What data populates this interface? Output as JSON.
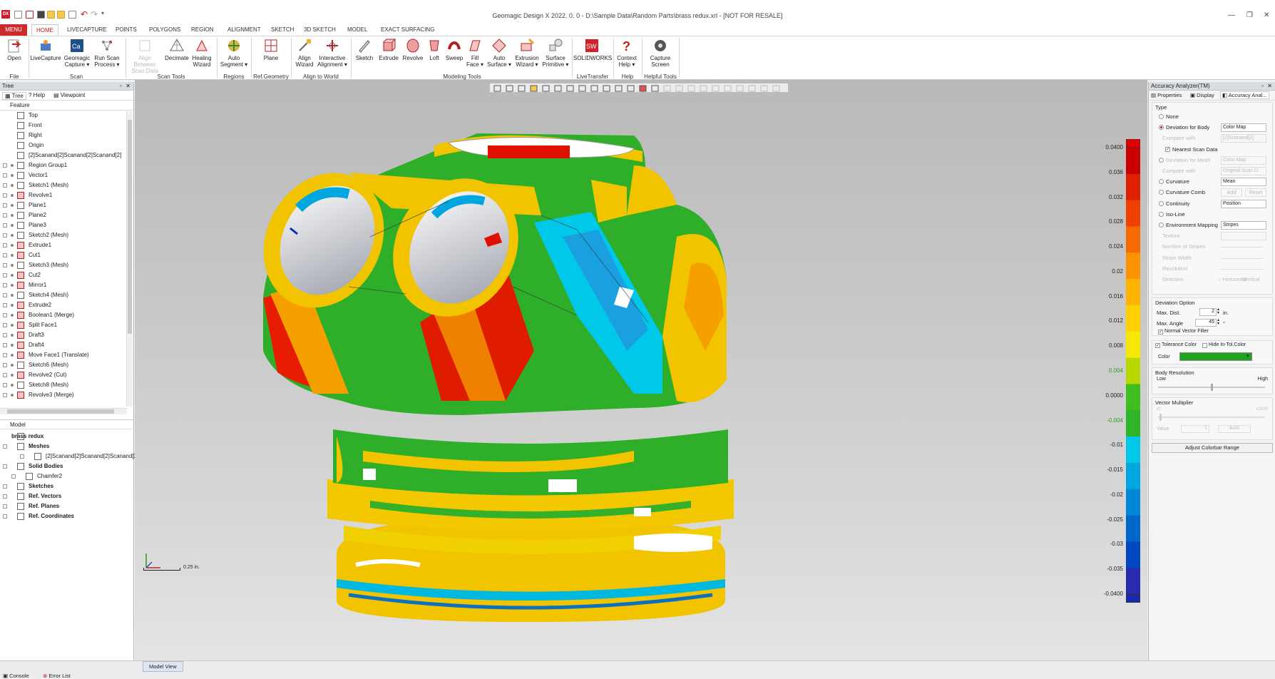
{
  "title_bar": {
    "app_icon_label": "DX",
    "title": "Geomagic Design X 2022. 0. 0 - D:\\Sample Data\\Random Parts\\brass redux.xrl - [NOT FOR RESALE]"
  },
  "menu": {
    "menu_button": "MENU",
    "tabs": [
      "HOME",
      "LIVECAPTURE",
      "POINTS",
      "POLYGONS",
      "REGION",
      "ALIGNMENT",
      "SKETCH",
      "3D SKETCH",
      "MODEL",
      "EXACT SURFACING"
    ]
  },
  "ribbon": {
    "buttons": [
      {
        "label": "Open",
        "icon": "open-icon"
      },
      {
        "label": "LiveCapture",
        "icon": "livecapture-icon"
      },
      {
        "label": "Geomagic Capture",
        "icon": "capture-icon"
      },
      {
        "label": "Run Scan Process",
        "icon": "scan-process-icon"
      },
      {
        "label": "Align Between Scan Data",
        "icon": "align-scan-icon"
      },
      {
        "label": "Decimate",
        "icon": "decimate-icon"
      },
      {
        "label": "Healing Wizard",
        "icon": "healing-icon"
      },
      {
        "label": "Auto Segment",
        "icon": "segment-icon"
      },
      {
        "label": "Plane",
        "icon": "plane-icon"
      },
      {
        "label": "Align Wizard",
        "icon": "align-wizard-icon"
      },
      {
        "label": "Interactive Alignment",
        "icon": "interactive-align-icon"
      },
      {
        "label": "Sketch",
        "icon": "sketch-icon"
      },
      {
        "label": "Extrude",
        "icon": "extrude-icon"
      },
      {
        "label": "Revolve",
        "icon": "revolve-icon"
      },
      {
        "label": "Loft",
        "icon": "loft-icon"
      },
      {
        "label": "Sweep",
        "icon": "sweep-icon"
      },
      {
        "label": "Fill Face",
        "icon": "fill-face-icon"
      },
      {
        "label": "Auto Surface",
        "icon": "auto-surface-icon"
      },
      {
        "label": "Extrusion Wizard",
        "icon": "extrusion-wizard-icon"
      },
      {
        "label": "Surface Primitive",
        "icon": "surface-primitive-icon"
      },
      {
        "label": "SOLIDWORKS",
        "icon": "solidworks-icon"
      },
      {
        "label": "Context Help",
        "icon": "help-icon"
      },
      {
        "label": "Capture Screen",
        "icon": "camera-icon"
      }
    ],
    "groups": [
      "File",
      "Scan",
      "Scan Tools",
      "Regions",
      "Ref.Geometry",
      "Align to World",
      "Modeling Tools",
      "LiveTransfer",
      "Help",
      "Helpful Tools"
    ]
  },
  "left_panel": {
    "header": "Tree",
    "tabs": [
      "Tree",
      "Help",
      "Viewpoint"
    ],
    "feature_header": "Feature",
    "feature_tree": [
      "Top",
      "Front",
      "Right",
      "Origin",
      "[2]Scanand[2]Scanand[2]Scanand[2]",
      "Region Group1",
      "Vector1",
      "Sketch1 (Mesh)",
      "Revolve1",
      "Plane1",
      "Plane2",
      "Plane3",
      "Sketch2 (Mesh)",
      "Extrude1",
      "Cut1",
      "Sketch3 (Mesh)",
      "Cut2",
      "Mirror1",
      "Sketch4 (Mesh)",
      "Extrude2",
      "Boolean1 (Merge)",
      "Split Face1",
      "Draft3",
      "Draft4",
      "Move Face1 (Translate)",
      "Sketch6 (Mesh)",
      "Revolve2 (Cut)",
      "Sketch8 (Mesh)",
      "Revolve3 (Merge)"
    ],
    "model_header": "Model",
    "model_tree": [
      "brass redux",
      "Meshes",
      "[2]Scanand[2]Scanand[2]Scanand[2",
      "Solid Bodies",
      "Chamfer2",
      "Sketches",
      "Ref. Vectors",
      "Ref. Planes",
      "Ref. Coordinates"
    ]
  },
  "viewport": {
    "scale_label": "0.25 in.",
    "tab": "Model View",
    "colorbar_ticks": [
      "0.0400",
      "0.036",
      "0.032",
      "0.028",
      "0.024",
      "0.02",
      "0.016",
      "0.012",
      "0.008",
      "0.004",
      "0.0000",
      "-0.004",
      "-0.01",
      "-0.015",
      "-0.02",
      "-0.025",
      "-0.03",
      "-0.035",
      "-0.0400"
    ],
    "colorbar_colors": [
      "#c80000",
      "#e01e00",
      "#f04000",
      "#f86a00",
      "#fc9200",
      "#ffb400",
      "#ffd000",
      "#f6e800",
      "#b8d800",
      "#3fbf1f",
      "#2fb52a",
      "#00c8e8",
      "#00a6e0",
      "#0086d6",
      "#0066cc",
      "#0048c0",
      "#2a2ab0"
    ]
  },
  "right_panel": {
    "header": "Accuracy Analyzer(TM)",
    "tabs": [
      "Properties",
      "Display",
      "Accuracy Anal..."
    ],
    "type_label": "Type",
    "options": [
      {
        "label": "None",
        "value": ""
      },
      {
        "label": "Deviation for Body",
        "value": "Color Map"
      },
      {
        "label": "Compare with",
        "value": "[2]Scanand[2]"
      },
      {
        "label": "Nearest Scan Data",
        "value": ""
      },
      {
        "label": "Deviation for Mesh",
        "value": "Color Map"
      },
      {
        "label": "Compare with",
        "value": "Original Scan D"
      },
      {
        "label": "Curvature",
        "value": "Mean"
      },
      {
        "label": "Curvature Comb",
        "value": ""
      },
      {
        "label": "Continuity",
        "value": "Position"
      },
      {
        "label": "Iso-Line",
        "value": ""
      },
      {
        "label": "Environment Mapping",
        "value": "Stripes"
      },
      {
        "label": "Texture",
        "value": ""
      },
      {
        "label": "Number of Stripes",
        "value": ""
      },
      {
        "label": "Stripe Width",
        "value": ""
      },
      {
        "label": "Resolution",
        "value": ""
      },
      {
        "label": "Direction",
        "value": "Horizontal"
      },
      {
        "label": "",
        "value": "Vertical"
      }
    ],
    "curvature_buttons": [
      "Add",
      "Reset"
    ],
    "deviation_option": {
      "title": "Deviation Option",
      "max_dist_label": "Max. Dist.",
      "max_dist_value": "2",
      "max_dist_unit": "in.",
      "max_angle_label": "Max. Angle",
      "max_angle_value": "45",
      "max_angle_unit": "°",
      "normal_filter": "Normal Vector Filter"
    },
    "tolerance": {
      "tolerance_color": "Tolerance Color",
      "hide_in_tol": "Hide In-Tol.Color",
      "color_label": "Color",
      "color": "#1ea31e"
    },
    "body_resolution": {
      "title": "Body Resolution",
      "low": "Low",
      "high": "High"
    },
    "vector_multiplier": {
      "title": "Vector Multiplier",
      "min": "x1",
      "max": "x1000",
      "value_label": "Value",
      "value": "1",
      "auto": "Auto"
    },
    "adjust_button": "Adjust Colorbar Range"
  },
  "status_bar": {
    "tabs": [
      "Console",
      "Error List"
    ]
  }
}
